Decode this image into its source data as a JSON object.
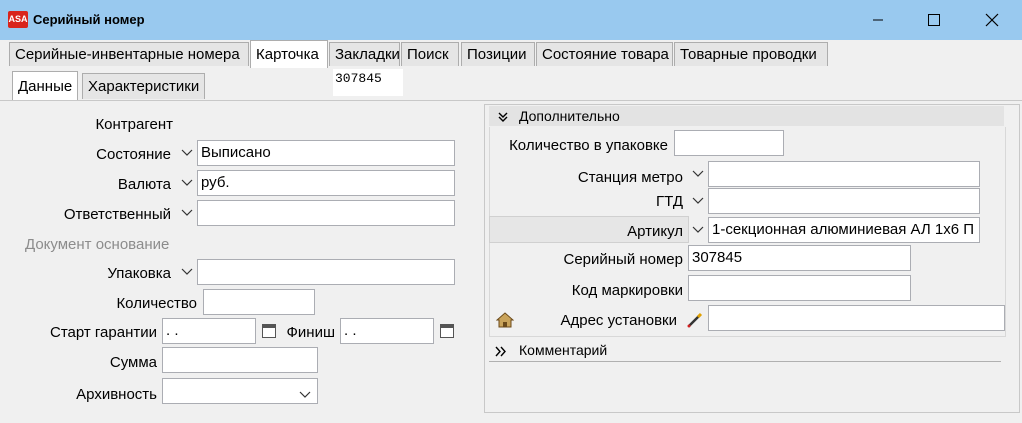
{
  "window": {
    "title": "Серийный номер",
    "logo_text": "ASA"
  },
  "tabs": [
    {
      "label": "Серийные-инвентарные номера"
    },
    {
      "label": "Карточка"
    },
    {
      "label": "Закладки"
    },
    {
      "label": "Поиск"
    },
    {
      "label": "Позиции"
    },
    {
      "label": "Состояние товара"
    },
    {
      "label": "Товарные проводки"
    }
  ],
  "subtabs": [
    {
      "label": "Данные"
    },
    {
      "label": "Характеристики"
    }
  ],
  "header_code": "307845",
  "left_form": {
    "kontragent_label": "Контрагент",
    "sostoyanie_label": "Состояние",
    "sostoyanie_value": "Выписано",
    "valyuta_label": "Валюта",
    "valyuta_value": "руб.",
    "otvetstvenny_label": "Ответственный",
    "otvetstvenny_value": "",
    "dokument_label": "Документ основание",
    "upakovka_label": "Упаковка",
    "upakovka_value": "",
    "kolichestvo_label": "Количество",
    "kolichestvo_value": "",
    "start_label": "Старт гарантии",
    "start_value": " .  .",
    "finish_label": "Финиш",
    "finish_value": " .  .",
    "summa_label": "Сумма",
    "summa_value": "",
    "arkhivnost_label": "Архивность",
    "arkhivnost_value": ""
  },
  "right_form": {
    "group_title": "Дополнительно",
    "kol_upak_label": "Количество в упаковке",
    "kol_upak_value": "",
    "stanciya_label": "Станция метро",
    "stanciya_value": "",
    "gtd_label": "ГТД",
    "gtd_value": "",
    "artikul_label": "Артикул",
    "artikul_value": "1-секционная алюминиевая АЛ 1х6 П",
    "serial_label": "Серийный номер",
    "serial_value": "307845",
    "kod_label": "Код маркировки",
    "kod_value": "",
    "adres_label": "Адрес установки",
    "adres_value": "",
    "comment_title": "Комментарий"
  }
}
